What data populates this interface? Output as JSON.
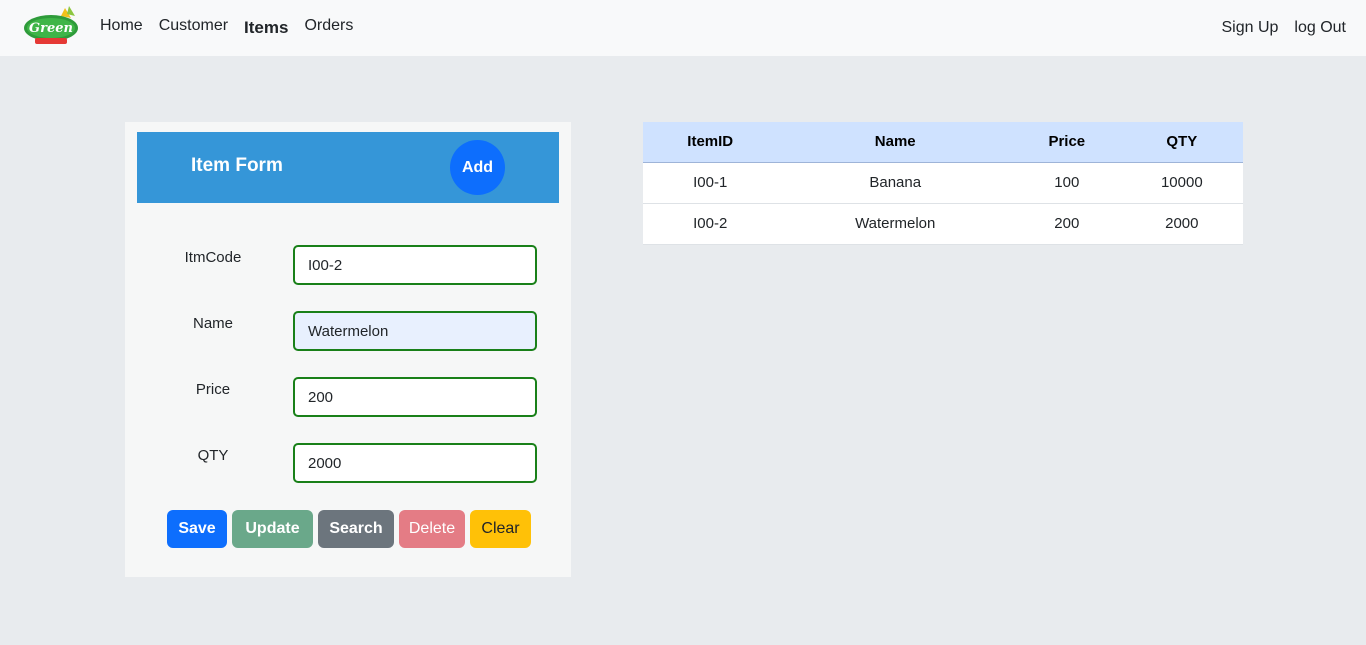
{
  "navbar": {
    "logo_text": "Green",
    "links": [
      "Home",
      "Customer",
      "Items",
      "Orders"
    ],
    "right_links": [
      "Sign Up",
      "log Out"
    ],
    "active": "Items"
  },
  "form": {
    "title": "Item Form",
    "add_label": "Add",
    "fields": [
      {
        "label": "ItmCode",
        "value": "I00-2"
      },
      {
        "label": "Name",
        "value": "Watermelon"
      },
      {
        "label": "Price",
        "value": "200"
      },
      {
        "label": "QTY",
        "value": "2000"
      }
    ],
    "buttons": {
      "save": "Save",
      "update": "Update",
      "search": "Search",
      "delete": "Delete",
      "clear": "Clear"
    }
  },
  "table": {
    "headers": [
      "ItemID",
      "Name",
      "Price",
      "QTY"
    ],
    "rows": [
      [
        "I00-1",
        "Banana",
        "100",
        "10000"
      ],
      [
        "I00-2",
        "Watermelon",
        "200",
        "2000"
      ]
    ]
  },
  "colors": {
    "navbar_bg": "#f8f9fa",
    "page_bg": "#e8ebee",
    "form_header": "#3596d8",
    "primary": "#0d6efd",
    "input_border": "#198019",
    "table_header": "#cfe2ff"
  }
}
